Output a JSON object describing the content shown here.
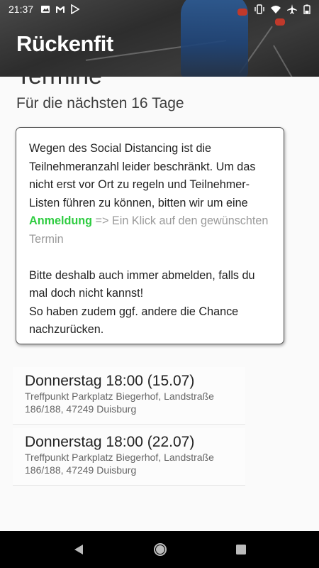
{
  "status": {
    "time": "21:37",
    "left_icons": [
      "image-icon",
      "gmail-icon",
      "play-store-icon"
    ],
    "right_icons": [
      "vibrate-icon",
      "wifi-icon",
      "airplane-icon",
      "battery-icon"
    ]
  },
  "header": {
    "title": "Rückenfit"
  },
  "section": {
    "title": "Termine",
    "subtitle": "Für die nächsten 16 Tage"
  },
  "info": {
    "p1_part1": "Wegen des Social Distancing ist die Teilnehmeranzahl leider beschränkt. Um das nicht erst vor Ort zu regeln und Teilnehmer-Listen führen zu können, bitten wir um eine ",
    "p1_link": "Anmeldung",
    "p1_part2": " => Ein Klick auf den gewünschten Termin",
    "p2_line1": "Bitte deshalb auch immer abmelden, falls du mal doch nicht kannst!",
    "p2_line2": "So haben zudem ggf. andere die Chance nachzurücken."
  },
  "events": [
    {
      "title": "Donnerstag 18:00 (15.07)",
      "location": "Treffpunkt Parkplatz Biegerhof, Landstraße 186/188, 47249 Duisburg"
    },
    {
      "title": "Donnerstag 18:00 (22.07)",
      "location": "Treffpunkt Parkplatz Biegerhof, Landstraße 186/188, 47249 Duisburg"
    }
  ],
  "colors": {
    "link": "#2ecc40",
    "header_bg": "#3a3a3a",
    "nav_bg": "#000000"
  }
}
